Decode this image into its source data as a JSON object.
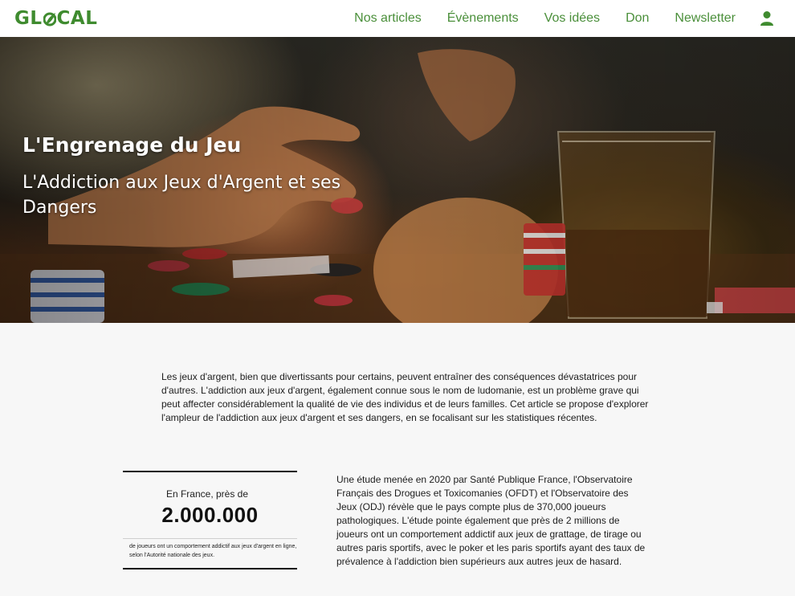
{
  "header": {
    "logo_text_before": "GL",
    "logo_text_after": "CAL",
    "logo_color": "#3f8b2f",
    "nav": [
      {
        "label": "Nos articles"
      },
      {
        "label": "Évènements"
      },
      {
        "label": "Vos idées"
      },
      {
        "label": "Don"
      },
      {
        "label": "Newsletter"
      }
    ],
    "user_icon": "user-icon",
    "nav_color": "#4a8f3a"
  },
  "hero": {
    "title": "L'Engrenage du Jeu",
    "subtitle": "L'Addiction aux Jeux d'Argent et ses Dangers"
  },
  "article": {
    "intro": "Les jeux d'argent, bien que divertissants pour certains, peuvent entraîner des conséquences dévastatrices pour d'autres. L'addiction aux jeux d'argent, également connue sous le nom de ludomanie, est un problème grave qui peut affecter considérablement la qualité de vie des individus et de leurs familles. Cet article se propose d'explorer l'ampleur de l'addiction aux jeux d'argent et ses dangers, en se focalisant sur les statistiques récentes.",
    "stat": {
      "lead": "En France, près de",
      "number": "2.000.000",
      "caption": "de joueurs ont un comportement addictif aux jeux d'argent en ligne, selon l'Autorité nationale des jeux."
    },
    "study": "Une étude menée en 2020 par Santé Publique France, l'Observatoire Français des Drogues et Toxicomanies (OFDT) et l'Observatoire des Jeux (ODJ) révèle que le pays compte plus de 370,000 joueurs pathologiques. L'étude pointe également que près de 2 millions de joueurs ont un comportement addictif aux jeux de grattage, de tirage ou autres paris sportifs, avec le poker et les paris sportifs ayant des taux de prévalence à l'addiction bien supérieurs aux autres jeux de hasard."
  }
}
